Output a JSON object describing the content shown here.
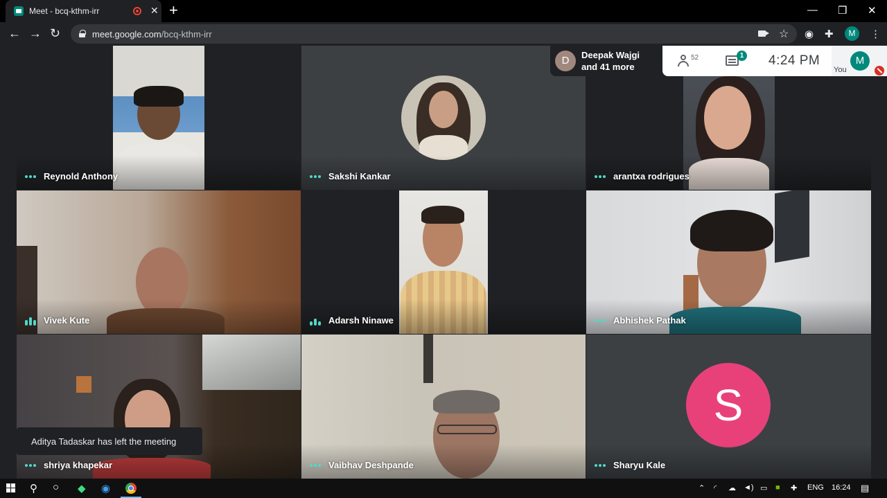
{
  "browser": {
    "tab_title": "Meet - bcq-kthm-irr",
    "tab_close": "✕",
    "new_tab": "+",
    "window_controls": {
      "minimize": "—",
      "maximize": "❐",
      "close": "✕"
    },
    "url_host": "meet.google.com",
    "url_path": "/bcq-kthm-irr",
    "profile_initial": "M",
    "icons": [
      "back-icon",
      "forward-icon",
      "reload-icon",
      "lock-icon",
      "camera-icon",
      "star-icon",
      "extension-circle-icon",
      "puzzle-icon",
      "menu-icon"
    ]
  },
  "meeting": {
    "active_speaker": {
      "initial": "D",
      "line1": "Deepak Wajgi",
      "line2": "and 41 more"
    },
    "participants_count": "52",
    "chat_unread": "1",
    "time": "4:24 PM",
    "self": {
      "initial": "M",
      "label": "You"
    },
    "toast": "Aditya Tadaskar has left the meeting",
    "tiles": [
      {
        "name": "Reynold Anthony",
        "indicator": "dots"
      },
      {
        "name": "Sakshi Kankar",
        "indicator": "dots"
      },
      {
        "name": "arantxa rodrigues",
        "indicator": "dots"
      },
      {
        "name": "Vivek Kute",
        "indicator": "bars"
      },
      {
        "name": "Adarsh Ninawe",
        "indicator": "bars"
      },
      {
        "name": "Abhishek Pathak",
        "indicator": "dots"
      },
      {
        "name": "shriya khapekar",
        "indicator": "dots"
      },
      {
        "name": "Vaibhav Deshpande",
        "indicator": "dots"
      },
      {
        "name": "Sharyu Kale",
        "indicator": "dots",
        "avatar_initial": "S",
        "avatar_color": "#e8417a"
      }
    ],
    "accent_color": "#00897b"
  },
  "taskbar": {
    "language": "ENG",
    "clock": "16:24",
    "apps": [
      "search-icon",
      "cortana-icon",
      "android-studio-icon",
      "edge-icon",
      "chrome-icon"
    ]
  }
}
